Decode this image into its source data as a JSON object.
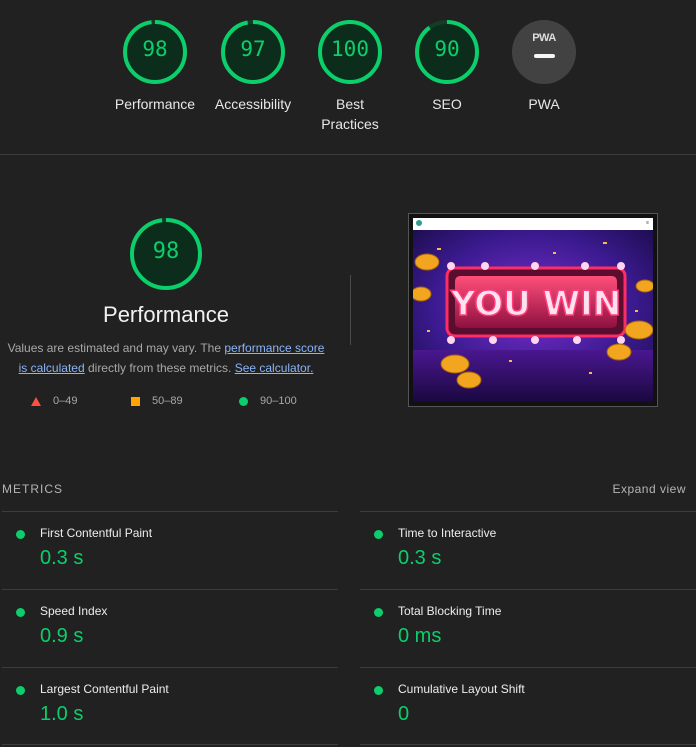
{
  "gauges": [
    {
      "score": "98",
      "label": "Performance",
      "fraction": 0.98
    },
    {
      "score": "97",
      "label": "Accessibility",
      "fraction": 0.97
    },
    {
      "score": "100",
      "label": "Best Practices",
      "fraction": 1.0
    },
    {
      "score": "90",
      "label": "SEO",
      "fraction": 0.9
    },
    {
      "badge_text": "PWA",
      "label": "PWA"
    }
  ],
  "performance": {
    "score": "98",
    "fraction": 0.98,
    "title": "Performance",
    "desc_prefix": "Values are estimated and may vary. The ",
    "desc_link1": "performance score is calculated",
    "desc_middle": " directly from these metrics. ",
    "desc_link2": "See calculator."
  },
  "legend": {
    "fail": "0–49",
    "average": "50–89",
    "pass": "90–100"
  },
  "thumbnail": {
    "banner_text": "YOU WIN",
    "brand_icon": "site-logo-icon"
  },
  "metrics": {
    "header": "METRICS",
    "expand": "Expand view",
    "items": [
      {
        "title": "First Contentful Paint",
        "value": "0.3 s"
      },
      {
        "title": "Time to Interactive",
        "value": "0.3 s"
      },
      {
        "title": "Speed Index",
        "value": "0.9 s"
      },
      {
        "title": "Total Blocking Time",
        "value": "0 ms"
      },
      {
        "title": "Largest Contentful Paint",
        "value": "1.0 s"
      },
      {
        "title": "Cumulative Layout Shift",
        "value": "0"
      }
    ]
  },
  "colors": {
    "pass": "#0cce6b",
    "average": "#ffa400",
    "fail": "#ff4e42",
    "link": "#8ab4f8",
    "background": "#212121"
  }
}
